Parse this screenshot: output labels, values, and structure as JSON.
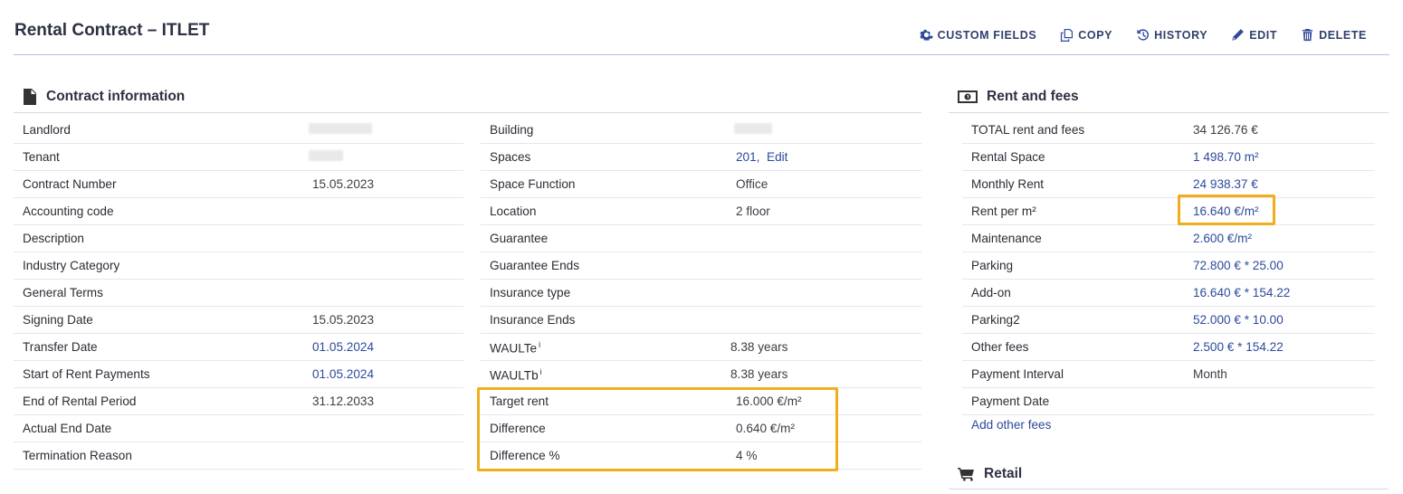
{
  "page": {
    "title": "Rental Contract – ITLET"
  },
  "toolbar": {
    "custom_fields": "CUSTOM FIELDS",
    "copy": "COPY",
    "history": "HISTORY",
    "edit": "EDIT",
    "delete": "DELETE"
  },
  "contract": {
    "heading": "Contract information",
    "left": [
      {
        "label": "Landlord",
        "value": ""
      },
      {
        "label": "Tenant",
        "value": ""
      },
      {
        "label": "Contract Number",
        "value": "15.05.2023"
      },
      {
        "label": "Accounting code",
        "value": ""
      },
      {
        "label": "Description",
        "value": ""
      },
      {
        "label": "Industry Category",
        "value": ""
      },
      {
        "label": "General Terms",
        "value": ""
      },
      {
        "label": "Signing Date",
        "value": "15.05.2023"
      },
      {
        "label": "Transfer Date",
        "value": "01.05.2024"
      },
      {
        "label": "Start of Rent Payments",
        "value": "01.05.2024"
      },
      {
        "label": "End of Rental Period",
        "value": "31.12.2033"
      },
      {
        "label": "Actual End Date",
        "value": ""
      },
      {
        "label": "Termination Reason",
        "value": ""
      }
    ],
    "right": [
      {
        "label": "Building",
        "value": ""
      },
      {
        "label": "Spaces",
        "value": "201,",
        "edit": "Edit"
      },
      {
        "label": "Space Function",
        "value": "Office"
      },
      {
        "label": "Location",
        "value": "2 floor"
      },
      {
        "label": "Guarantee",
        "value": ""
      },
      {
        "label": "Guarantee Ends",
        "value": ""
      },
      {
        "label": "Insurance type",
        "value": ""
      },
      {
        "label": "Insurance Ends",
        "value": ""
      },
      {
        "label": "WAULTe",
        "sup": "i",
        "value": "8.38 years"
      },
      {
        "label": "WAULTb",
        "sup": "i",
        "value": "8.38 years"
      },
      {
        "label": "Target rent",
        "value": "16.000 €/m²"
      },
      {
        "label": "Difference",
        "value": "0.640 €/m²"
      },
      {
        "label": "Difference %",
        "value": "4 %"
      }
    ]
  },
  "rent": {
    "heading": "Rent and fees",
    "rows": [
      {
        "label": "TOTAL rent and fees",
        "value": "34 126.76 €"
      },
      {
        "label": "Rental Space",
        "value": "1 498.70 m²"
      },
      {
        "label": "Monthly Rent",
        "value": "24 938.37 €"
      },
      {
        "label": "Rent per m²",
        "value": "16.640 €/m²"
      },
      {
        "label": "Maintenance",
        "value": "2.600 €/m²"
      },
      {
        "label": "Parking",
        "value": "72.800 € * 25.00"
      },
      {
        "label": "Add-on",
        "value": "16.640 € * 154.22"
      },
      {
        "label": "Parking2",
        "value": "52.000 € * 10.00"
      },
      {
        "label": "Other fees",
        "value": "2.500 € * 154.22"
      },
      {
        "label": "Payment Interval",
        "value": "Month"
      },
      {
        "label": "Payment Date",
        "value": ""
      }
    ],
    "add_other_fees": "Add other fees"
  },
  "retail": {
    "heading": "Retail"
  },
  "colors": {
    "accent": "#2d4a9c",
    "highlight": "#f0ad1c"
  },
  "icons": [
    "gear-icon",
    "copy-icon",
    "history-icon",
    "pencil-icon",
    "trash-icon",
    "document-icon",
    "money-icon",
    "cart-icon"
  ]
}
